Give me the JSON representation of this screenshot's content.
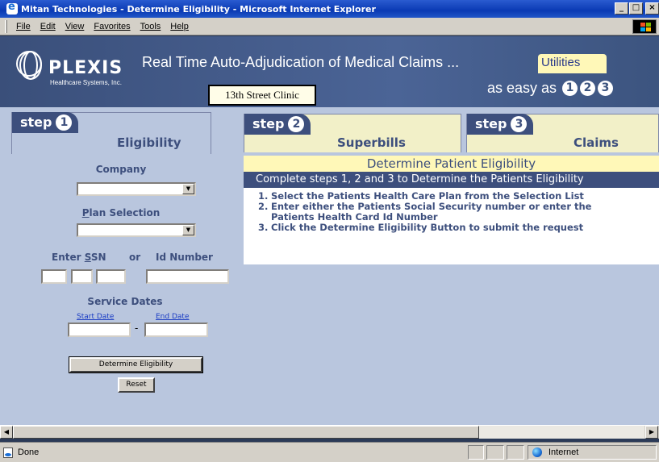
{
  "window": {
    "title": "Mitan Technologies - Determine Eligibility - Microsoft Internet Explorer",
    "minimize_glyph": "_",
    "maximize_glyph": "□",
    "close_glyph": "×"
  },
  "menu": [
    "File",
    "Edit",
    "View",
    "Favorites",
    "Tools",
    "Help"
  ],
  "header": {
    "logo_name": "PLEXIS",
    "logo_sub": "Healthcare Systems, Inc.",
    "title": "Real Time Auto-Adjudication of Medical Claims ...",
    "utilities": "Utilities",
    "easy": "as easy as",
    "steps": [
      "1",
      "2",
      "3"
    ],
    "clinic": "13th Street Clinic"
  },
  "tabs": [
    {
      "step": "step",
      "num": "1",
      "label": "Eligibility"
    },
    {
      "step": "step",
      "num": "2",
      "label": "Superbills"
    },
    {
      "step": "step",
      "num": "3",
      "label": "Claims"
    }
  ],
  "form": {
    "company_label": "Company",
    "company_value": "",
    "plan_label_first": "P",
    "plan_label_rest": "lan Selection",
    "plan_value": "",
    "ssn_label_enter": "Enter ",
    "ssn_label_s": "S",
    "ssn_label_rest": "SN",
    "or_label": "or",
    "id_label": "Id Number",
    "service_dates_label": "Service Dates",
    "start_date_link": "Start Date",
    "end_date_link": "End Date",
    "date_separator": "-",
    "determine_button": "Determine Eligibility",
    "reset_button": "Reset"
  },
  "instructions": {
    "title": "Determine Patient Eligibility",
    "subtitle": "Complete steps 1, 2 and 3 to Determine the Patients Eligibility",
    "items": [
      {
        "num": "1.",
        "text": "Select the Patients Health Care Plan from the Selection List"
      },
      {
        "num": "2.",
        "text": "Enter either the Patients Social Security number or enter the"
      },
      {
        "num": "",
        "text": "Patients Health Card Id Number"
      },
      {
        "num": "3.",
        "text": "Click the Determine Eligibility Button to submit the request"
      }
    ]
  },
  "status": {
    "left": "Done",
    "zone": "Internet"
  },
  "scroll": {
    "left_arrow": "◀",
    "right_arrow": "▶"
  }
}
